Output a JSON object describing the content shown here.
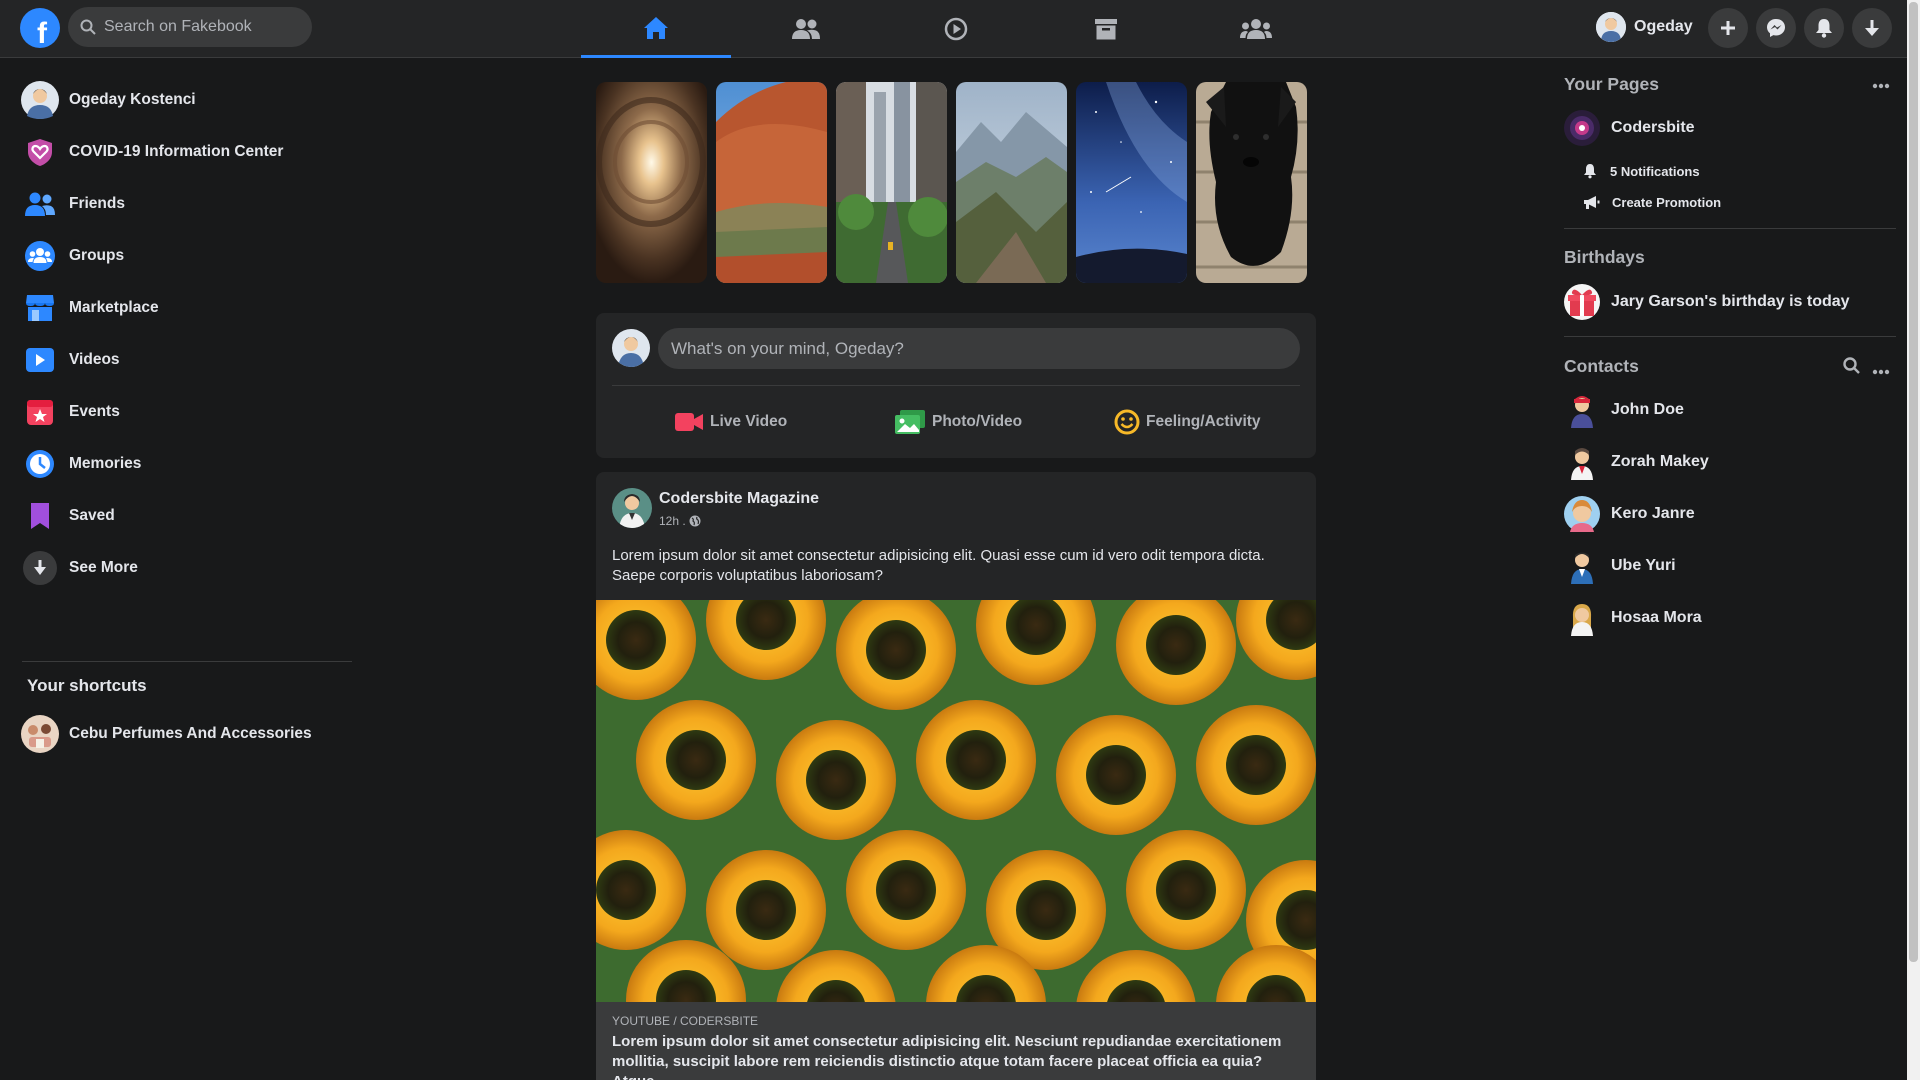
{
  "header": {
    "logo_letter": "f",
    "search_placeholder": "Search on Fakebook",
    "nav_tabs": [
      "home-icon",
      "friends-icon",
      "watch-icon",
      "marketplace-icon",
      "groups-icon"
    ],
    "active_tab": "home",
    "profile_name": "Ogeday",
    "accent_color": "#2d88ff"
  },
  "left_sidebar": {
    "items": [
      {
        "label": "Ogeday Kostenci",
        "icon": "avatar"
      },
      {
        "label": "COVID-19 Information Center",
        "icon": "covid-heart-icon"
      },
      {
        "label": "Friends",
        "icon": "friends-icon"
      },
      {
        "label": "Groups",
        "icon": "groups-icon"
      },
      {
        "label": "Marketplace",
        "icon": "marketplace-icon"
      },
      {
        "label": "Videos",
        "icon": "videos-icon"
      },
      {
        "label": "Events",
        "icon": "events-icon"
      },
      {
        "label": "Memories",
        "icon": "memories-icon"
      },
      {
        "label": "Saved",
        "icon": "saved-icon"
      },
      {
        "label": "See More",
        "icon": "arrow-down-icon"
      }
    ],
    "shortcuts_heading": "Your shortcuts",
    "shortcuts": [
      {
        "label": "Cebu Perfumes And Accessories"
      }
    ]
  },
  "composer": {
    "placeholder": "What's on your mind, Ogeday?",
    "actions": [
      {
        "label": "Live Video",
        "icon": "live-video-icon",
        "color": "#f3425f"
      },
      {
        "label": "Photo/Video",
        "icon": "photo-icon",
        "color": "#45bd62"
      },
      {
        "label": "Feeling/Activity",
        "icon": "feeling-icon",
        "color": "#f7b928"
      }
    ]
  },
  "post": {
    "author": "Codersbite Magazine",
    "time": "12h .",
    "text": "Lorem ipsum dolor sit amet consectetur adipisicing elit. Quasi esse cum id vero odit tempora dicta. Saepe corporis voluptatibus laboriosam?",
    "link_source": "YOUTUBE / CODERSBITE",
    "link_title": "Lorem ipsum dolor sit amet consectetur adipisicing elit. Nesciunt repudiandae exercitationem mollitia, suscipit labore rem reiciendis distinctio atque totam facere placeat officia ea quia? Atque."
  },
  "right_sidebar": {
    "pages_heading": "Your Pages",
    "page_name": "Codersbite",
    "notifications": "5 Notifications",
    "create_promotion": "Create Promotion",
    "birthdays_heading": "Birthdays",
    "birthday_text": "Jary Garson's birthday is today",
    "contacts_heading": "Contacts",
    "contacts": [
      "John Doe",
      "Zorah Makey",
      "Kero Janre",
      "Ube Yuri",
      "Hosaa Mora"
    ]
  }
}
